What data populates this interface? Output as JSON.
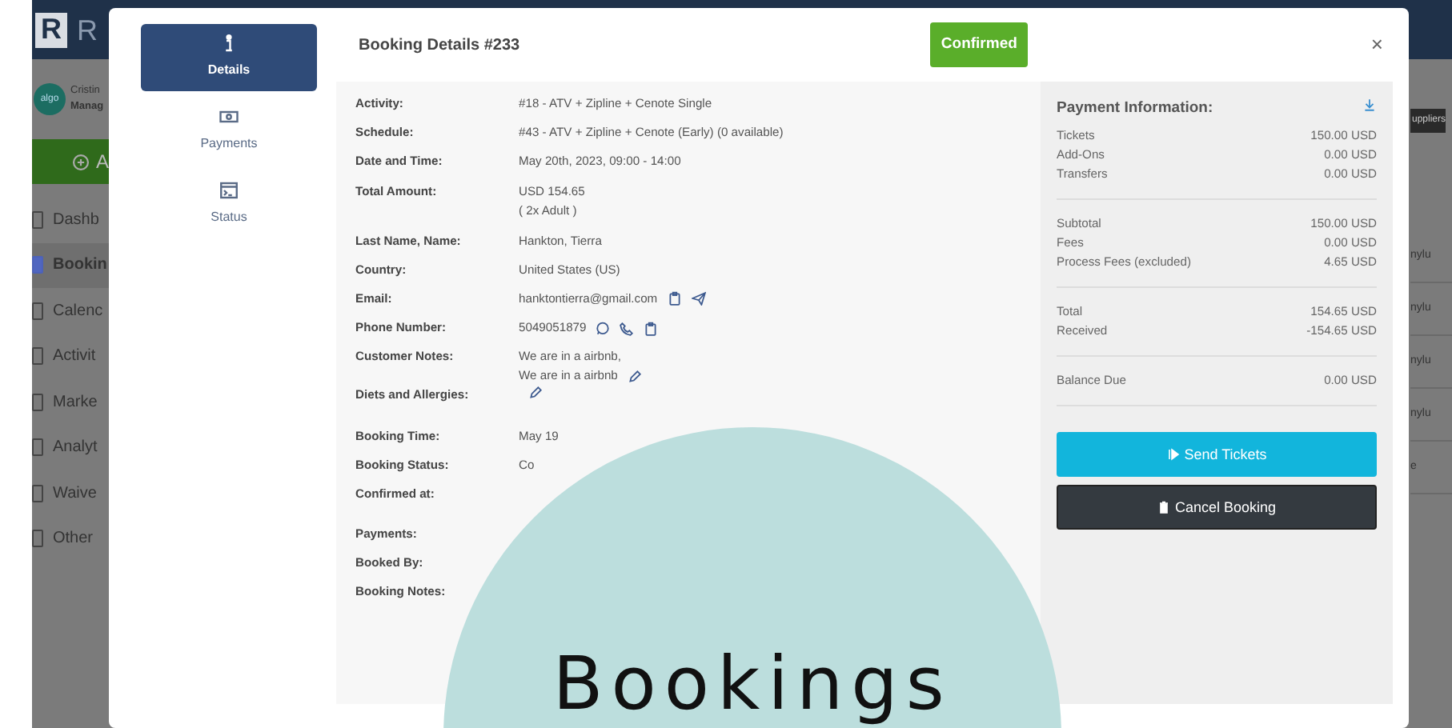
{
  "app": {
    "logo_letter": "R",
    "logo_text": "R",
    "avatar_text": "algo",
    "user_name": "Cristin",
    "user_role": "Manag",
    "add_button": "A",
    "nav": [
      {
        "label": "Dashb",
        "selected": false
      },
      {
        "label": "Bookin",
        "selected": true
      },
      {
        "label": "Calenc",
        "selected": false
      },
      {
        "label": "Activit",
        "selected": false
      },
      {
        "label": "Marke",
        "selected": false
      },
      {
        "label": "Analyt",
        "selected": false
      },
      {
        "label": "Waive",
        "selected": false
      },
      {
        "label": "Other",
        "selected": false
      }
    ],
    "toolbar_button": "uppliers",
    "row_fragments": [
      "nylu",
      "nylu",
      "nylu",
      "nylu",
      "e"
    ]
  },
  "modal": {
    "tabs": [
      {
        "label": "Details",
        "kind": "info",
        "selected": true
      },
      {
        "label": "Payments",
        "kind": "money",
        "selected": false
      },
      {
        "label": "Status",
        "kind": "terminal",
        "selected": false
      }
    ],
    "title": "Booking Details #233",
    "status": "Confirmed",
    "close": "×",
    "details": [
      [
        {
          "label": "Activity:",
          "lines": [
            "#18 - ATV + Zipline + Cenote Single"
          ]
        },
        {
          "label": "Schedule:",
          "lines": [
            "#43 - ATV + Zipline + Cenote (Early) (0 available)"
          ]
        },
        {
          "label": "Date and Time:",
          "lines": [
            "May 20th, 2023, 09:00 - 14:00"
          ]
        },
        {
          "label": "Total Amount:",
          "lines": [
            "USD 154.65",
            "( 2x Adult )"
          ]
        }
      ],
      [
        {
          "label": "Last Name, Name:",
          "lines": [
            "Hankton, Tierra"
          ]
        },
        {
          "label": "Country:",
          "lines": [
            "United States (US)"
          ]
        },
        {
          "label": "Email:",
          "lines": [
            "hanktontierra@gmail.com"
          ],
          "actions": [
            {
              "kind": "copy"
            },
            {
              "kind": "send"
            }
          ]
        },
        {
          "label": "Phone Number:",
          "lines": [
            "5049051879"
          ],
          "actions": [
            {
              "kind": "whatsapp"
            },
            {
              "kind": "phone"
            },
            {
              "kind": "copy"
            }
          ]
        },
        {
          "label": "Customer Notes:",
          "lines": [
            "We are in a airbnb,",
            "We are in a airbnb"
          ],
          "actions": [
            {
              "kind": "edit"
            }
          ]
        },
        {
          "label": "Diets and Allergies:",
          "actions": [
            {
              "kind": "edit"
            }
          ]
        }
      ],
      [
        {
          "label": "Booking Time:",
          "lines": [
            "May 19"
          ]
        },
        {
          "label": "Booking Status:",
          "lines": [
            "Co"
          ]
        },
        {
          "label": "Confirmed at:"
        }
      ],
      [
        {
          "label": "Payments:"
        },
        {
          "label": "Booked By:"
        },
        {
          "label": "Booking Notes:"
        }
      ]
    ],
    "payment": {
      "title": "Payment Information:",
      "groups": [
        [
          {
            "label": "Tickets",
            "value": "150.00 USD"
          },
          {
            "label": "Add-Ons",
            "value": "0.00 USD"
          },
          {
            "label": "Transfers",
            "value": "0.00 USD"
          }
        ],
        [
          {
            "label": "Subtotal",
            "value": "150.00 USD"
          },
          {
            "label": "Fees",
            "value": "0.00 USD"
          },
          {
            "label": "Process Fees (excluded)",
            "value": "4.65 USD"
          }
        ],
        [
          {
            "label": "Total",
            "value": "154.65 USD"
          },
          {
            "label": "Received",
            "value": "-154.65 USD"
          }
        ],
        [
          {
            "label": "Balance Due",
            "value": "0.00 USD"
          }
        ]
      ],
      "buttons": [
        {
          "label": "Send Tickets",
          "kind": "send"
        },
        {
          "label": "Cancel Booking",
          "kind": "cancel"
        }
      ]
    }
  },
  "overlay": {
    "title": "Bookings"
  }
}
